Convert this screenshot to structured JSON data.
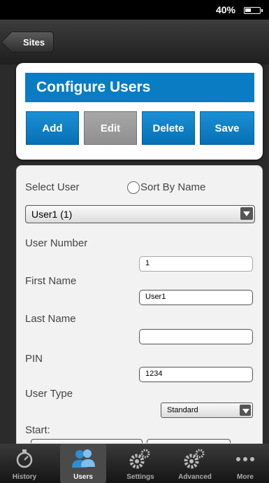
{
  "status_bar": {
    "battery_percent": "40%"
  },
  "nav": {
    "back_label": "Sites"
  },
  "header": {
    "title": "Configure Users"
  },
  "actions": {
    "add": "Add",
    "edit": "Edit",
    "delete": "Delete",
    "save": "Save"
  },
  "form": {
    "select_user_label": "Select User",
    "sort_by_name_label": "Sort By Name",
    "sort_by_name_checked": false,
    "selected_user": "User1 (1)",
    "user_number_label": "User Number",
    "user_number_value": "1",
    "first_name_label": "First Name",
    "first_name_value": "User1",
    "last_name_label": "Last Name",
    "last_name_value": "",
    "pin_label": "PIN",
    "pin_value": "1234",
    "user_type_label": "User Type",
    "user_type_value": "Standard",
    "start_label": "Start:"
  },
  "tabs": [
    {
      "label": "History",
      "icon": "stopwatch-icon",
      "active": false
    },
    {
      "label": "Users",
      "icon": "users-icon",
      "active": true
    },
    {
      "label": "Settings",
      "icon": "gears-icon",
      "active": false
    },
    {
      "label": "Advanced",
      "icon": "gears-icon",
      "active": false
    },
    {
      "label": "More",
      "icon": "more-dots-icon",
      "active": false
    }
  ],
  "colors": {
    "accent": "#0A7CC4",
    "edit_button": "#9B9B9B"
  }
}
